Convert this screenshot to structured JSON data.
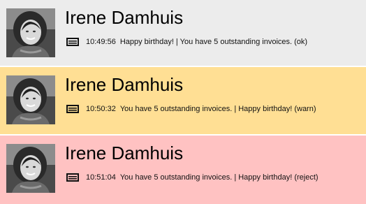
{
  "notifications": [
    {
      "name": "Irene Damhuis",
      "time": "10:49:56",
      "message": "Happy birthday! | You have 5 outstanding invoices. (ok)",
      "status": "ok",
      "background": "#ececec",
      "icon": "message-icon"
    },
    {
      "name": "Irene Damhuis",
      "time": "10:50:32",
      "message": "You have 5 outstanding invoices. | Happy birthday! (warn)",
      "status": "warn",
      "background": "#ffdf94",
      "icon": "message-icon"
    },
    {
      "name": "Irene Damhuis",
      "time": "10:51:04",
      "message": "You have 5 outstanding invoices. | Happy birthday! (reject)",
      "status": "reject",
      "background": "#ffc2c2",
      "icon": "message-icon"
    }
  ]
}
